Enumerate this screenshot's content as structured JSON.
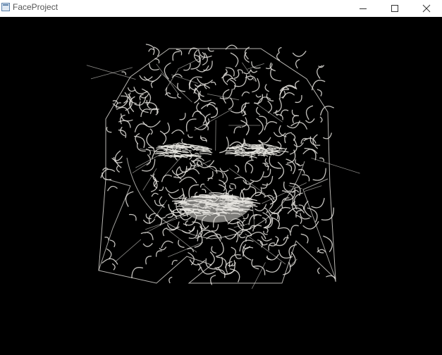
{
  "window": {
    "title": "FaceProject",
    "icon": "app-window-icon",
    "controls": [
      "minimize-icon",
      "maximize-icon",
      "close-icon"
    ]
  },
  "canvas": {
    "background": "#000000",
    "stroke_color": "#e6e4df",
    "content": "wireframe-face-render"
  }
}
